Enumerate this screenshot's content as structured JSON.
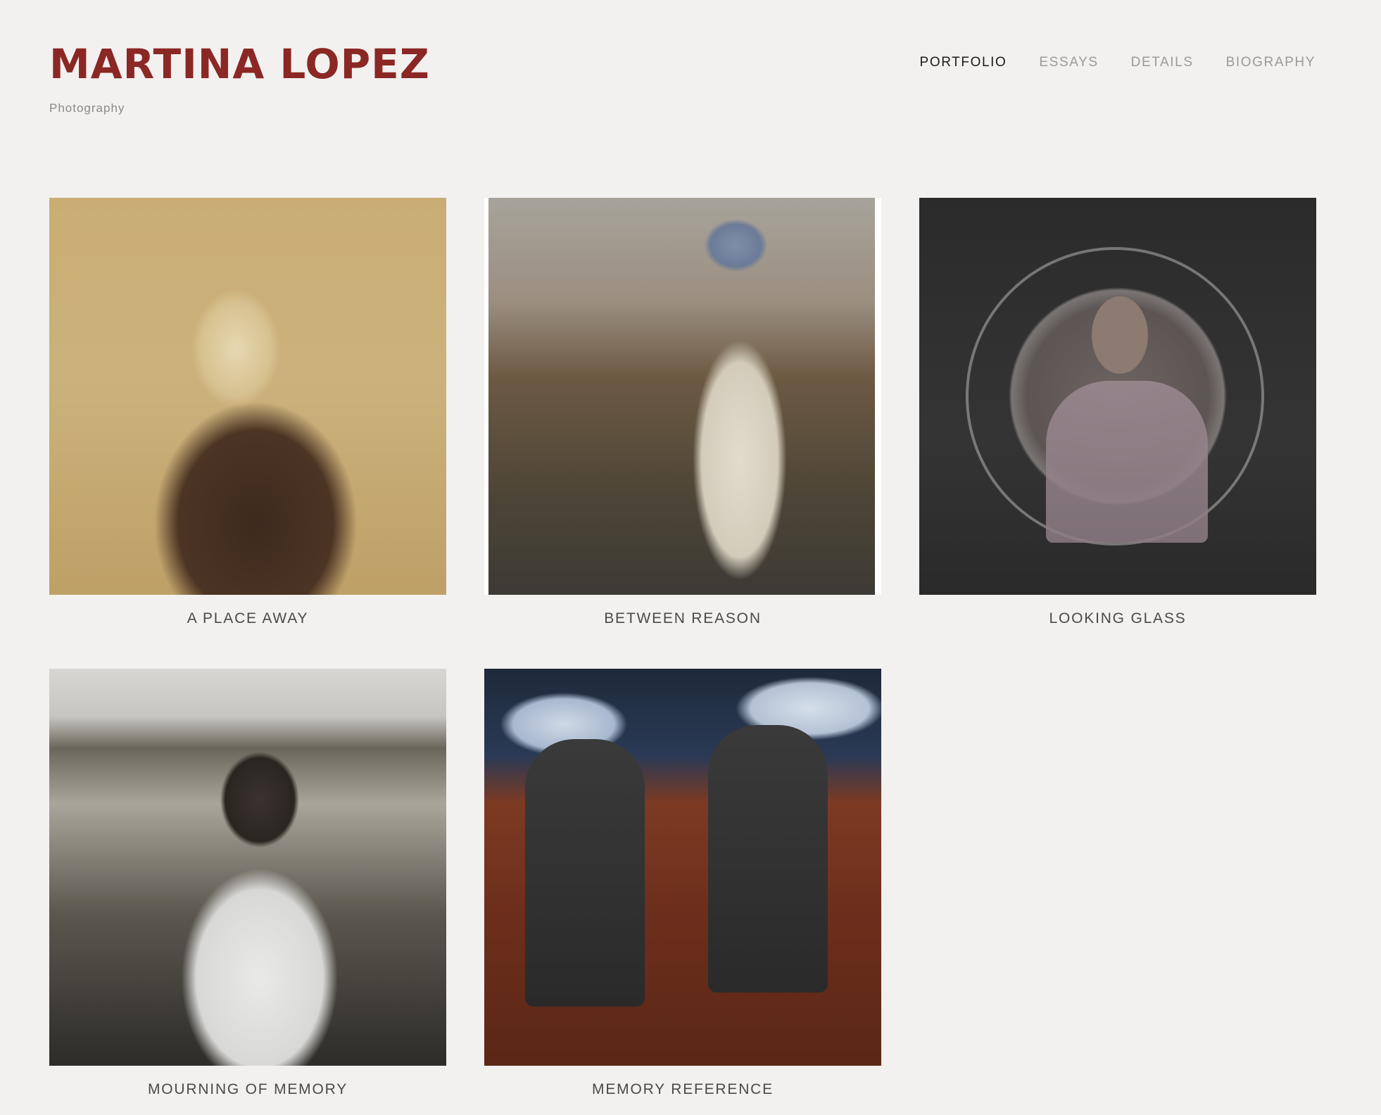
{
  "site": {
    "title": "MARTINA LOPEZ",
    "tagline": "Photography"
  },
  "nav": {
    "items": [
      {
        "label": "PORTFOLIO",
        "active": true
      },
      {
        "label": "ESSAYS",
        "active": false
      },
      {
        "label": "DETAILS",
        "active": false
      },
      {
        "label": "BIOGRAPHY",
        "active": false
      }
    ]
  },
  "portfolio": {
    "items": [
      {
        "caption": "A PLACE AWAY"
      },
      {
        "caption": "BETWEEN REASON"
      },
      {
        "caption": "LOOKING GLASS"
      },
      {
        "caption": "MOURNING OF MEMORY"
      },
      {
        "caption": "MEMORY REFERENCE"
      }
    ]
  },
  "colors": {
    "brand": "#8b2724",
    "background": "#f2f1ef",
    "nav_active": "#1b1b1b",
    "nav_inactive": "#9a9a9a"
  }
}
